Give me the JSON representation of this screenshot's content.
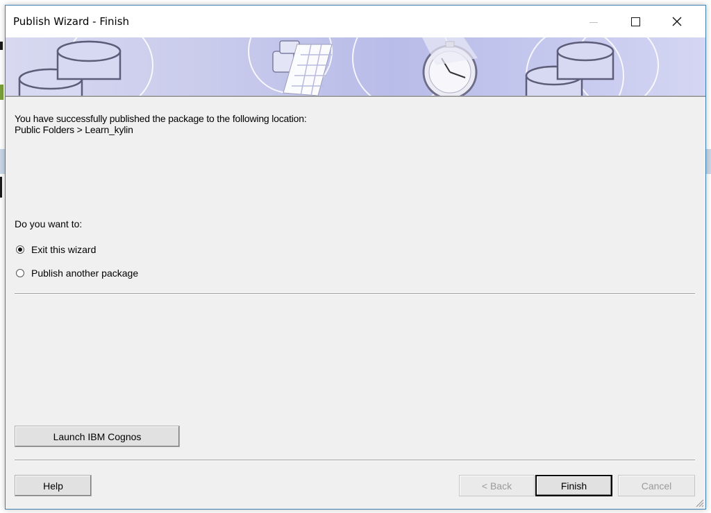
{
  "window": {
    "title": "Publish Wizard - Finish",
    "controls": {
      "minimize": "minimize-icon",
      "maximize": "maximize-icon",
      "close": "close-icon"
    }
  },
  "banner": {
    "image": "publish-wizard-banner"
  },
  "message": {
    "line1": "You have successfully published the package to the following location:",
    "line2": "Public Folders > Learn_kylin"
  },
  "question": "Do you want to:",
  "options": [
    {
      "label": "Exit this wizard",
      "selected": true
    },
    {
      "label": "Publish another package",
      "selected": false
    }
  ],
  "buttons": {
    "launch": "Launch IBM Cognos",
    "help": "Help",
    "back": "< Back",
    "finish": "Finish",
    "cancel": "Cancel"
  },
  "colors": {
    "window_border": "#3c7fb1",
    "dialog_bg": "#f0f0f0",
    "banner_tint": "#c9cbec"
  }
}
